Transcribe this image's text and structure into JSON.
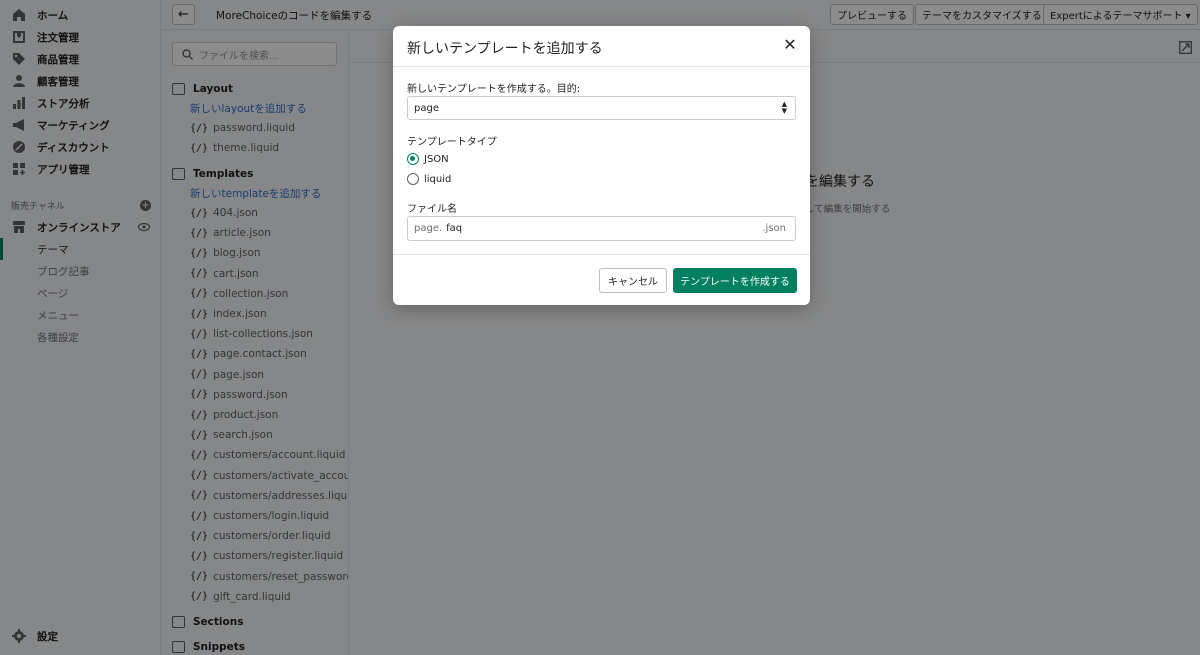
{
  "admin_nav": {
    "items": [
      {
        "label": "ホーム",
        "icon": "home-icon"
      },
      {
        "label": "注文管理",
        "icon": "orders-icon"
      },
      {
        "label": "商品管理",
        "icon": "tag-icon"
      },
      {
        "label": "顧客管理",
        "icon": "person-icon"
      },
      {
        "label": "ストア分析",
        "icon": "bar-chart-icon"
      },
      {
        "label": "マーケティング",
        "icon": "megaphone-icon"
      },
      {
        "label": "ディスカウント",
        "icon": "discount-icon"
      },
      {
        "label": "アプリ管理",
        "icon": "apps-icon"
      }
    ],
    "sales_channel_label": "販売チャネル",
    "online_store": "オンラインストア",
    "sub_items": [
      "テーマ",
      "ブログ記事",
      "ページ",
      "メニュー",
      "各種設定"
    ],
    "settings": "設定"
  },
  "topbar": {
    "title": "MoreChoiceのコードを編集する",
    "preview": "プレビューする",
    "customize": "テーマをカスタマイズする",
    "expert": "Expertによるテーマサポート ▾"
  },
  "files": {
    "search_placeholder": "ファイルを検索...",
    "layout_folder": "Layout",
    "layout_add": "新しいlayoutを追加する",
    "layout_files": [
      "password.liquid",
      "theme.liquid"
    ],
    "templates_folder": "Templates",
    "templates_add": "新しいtemplateを追加する",
    "template_files": [
      "404.json",
      "article.json",
      "blog.json",
      "cart.json",
      "collection.json",
      "index.json",
      "list-collections.json",
      "page.contact.json",
      "page.json",
      "password.json",
      "product.json",
      "search.json",
      "customers/account.liquid",
      "customers/activate_account.liquid",
      "customers/addresses.liquid",
      "customers/login.liquid",
      "customers/order.liquid",
      "customers/register.liquid",
      "customers/reset_password.liquid",
      "gift_card.liquid"
    ],
    "sections_folder": "Sections",
    "snippets_folder": "Snippets",
    "file_icon_glyph": "{/}"
  },
  "editor": {
    "empty_title": "を編集する",
    "empty_sub": "して編集を開始する"
  },
  "modal": {
    "title": "新しいテンプレートを追加する",
    "purpose_label": "新しいテンプレートを作成する。目的:",
    "purpose_value": "page",
    "type_label": "テンプレートタイプ",
    "type_options": [
      "JSON",
      "liquid"
    ],
    "type_selected": "JSON",
    "filename_label": "ファイル名",
    "filename_prefix": "page.",
    "filename_value": "faq",
    "filename_suffix": ".json",
    "cancel": "キャンセル",
    "create": "テンプレートを作成する"
  },
  "colors": {
    "primary": "#008060",
    "link": "#2c6ecb"
  }
}
